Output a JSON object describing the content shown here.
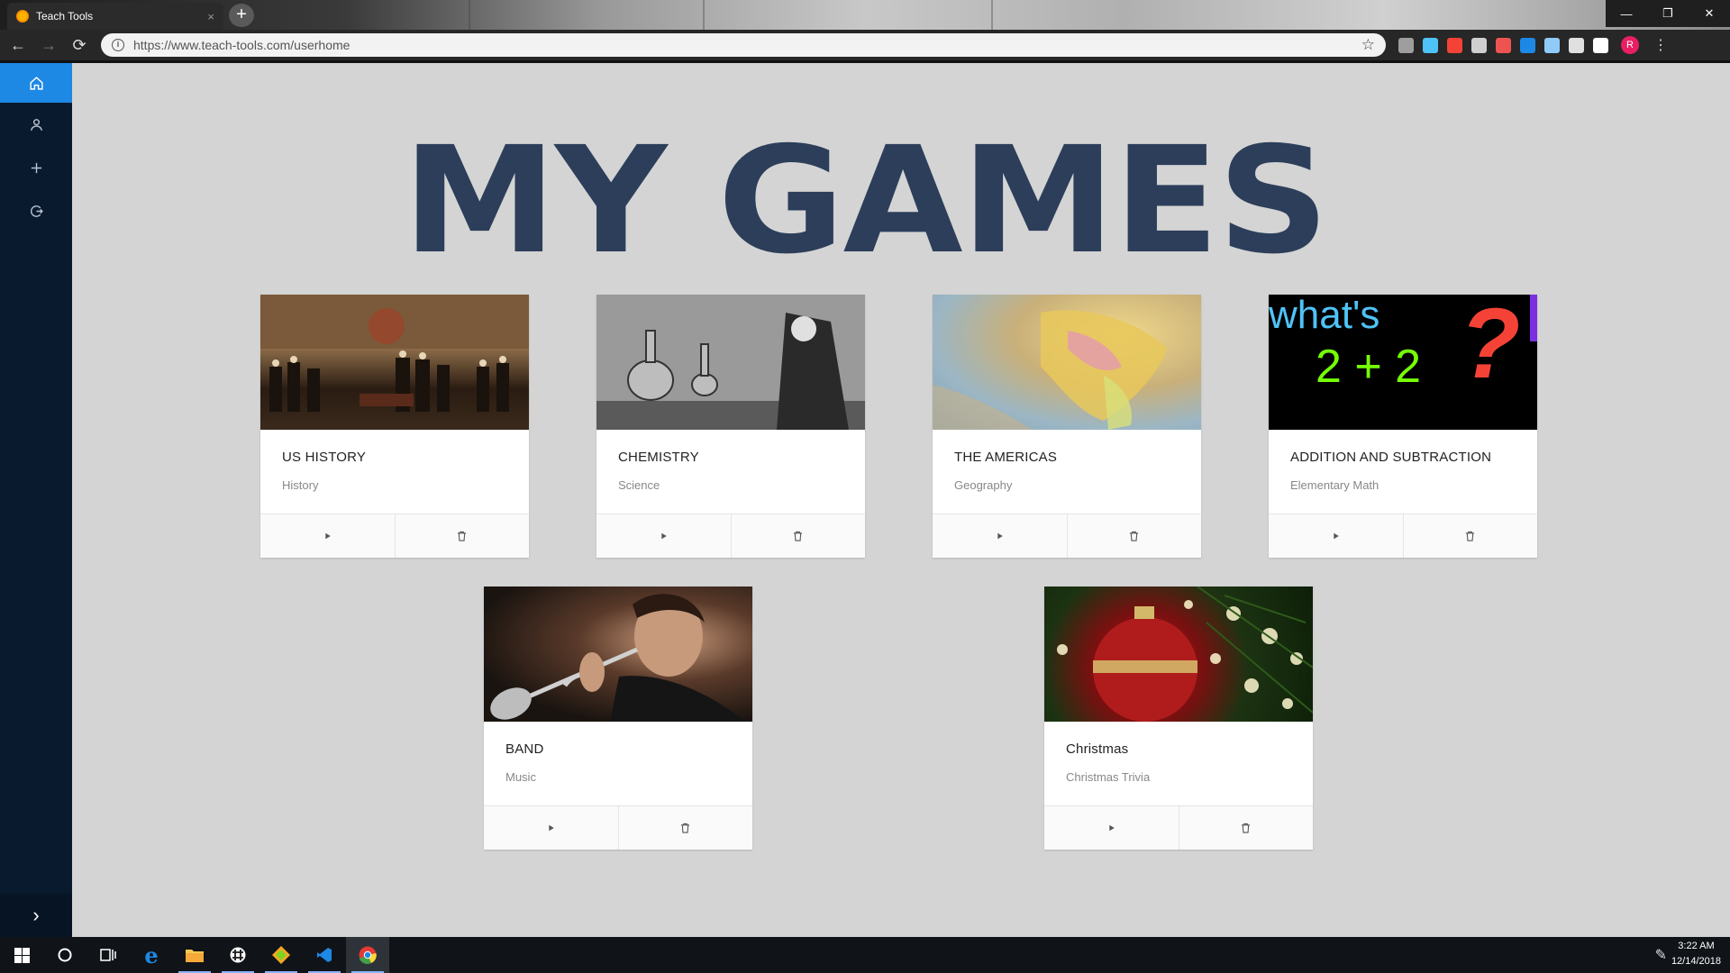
{
  "browser": {
    "tab_title": "Teach Tools",
    "tab_close": "×",
    "new_tab": "+",
    "url": "https://www.teach-tools.com/userhome",
    "window_controls": {
      "minimize": "—",
      "restore": "❐",
      "close": "✕"
    },
    "back": "←",
    "forward": "→",
    "reload": "⟳",
    "star": "☆",
    "menu": "⋮",
    "profile_initial": "R",
    "extension_colors": [
      "#9e9e9e",
      "#4fc3f7",
      "#f44336",
      "#cfcfcf",
      "#ef5350",
      "#1e88e5",
      "#90caf9",
      "#e0e0e0",
      "#ffffff"
    ]
  },
  "sidebar": {
    "items": [
      {
        "icon": "home-icon"
      },
      {
        "icon": "user-icon"
      },
      {
        "icon": "plus-icon"
      },
      {
        "icon": "logout-icon"
      }
    ],
    "expand": "›"
  },
  "main": {
    "title": "MY GAMES",
    "games": [
      {
        "title": "US HISTORY",
        "subject": "History"
      },
      {
        "title": "CHEMISTRY",
        "subject": "Science"
      },
      {
        "title": "THE AMERICAS",
        "subject": "Geography"
      },
      {
        "title": "ADDITION AND SUBTRACTION",
        "subject": "Elementary Math",
        "thumb_line1": "what's",
        "thumb_line2": "2 + 2",
        "thumb_q": "?"
      },
      {
        "title": "BAND",
        "subject": "Music"
      },
      {
        "title": "Christmas",
        "subject": "Christmas Trivia"
      }
    ]
  },
  "taskbar": {
    "time": "3:22 AM",
    "date": "12/14/2018"
  }
}
